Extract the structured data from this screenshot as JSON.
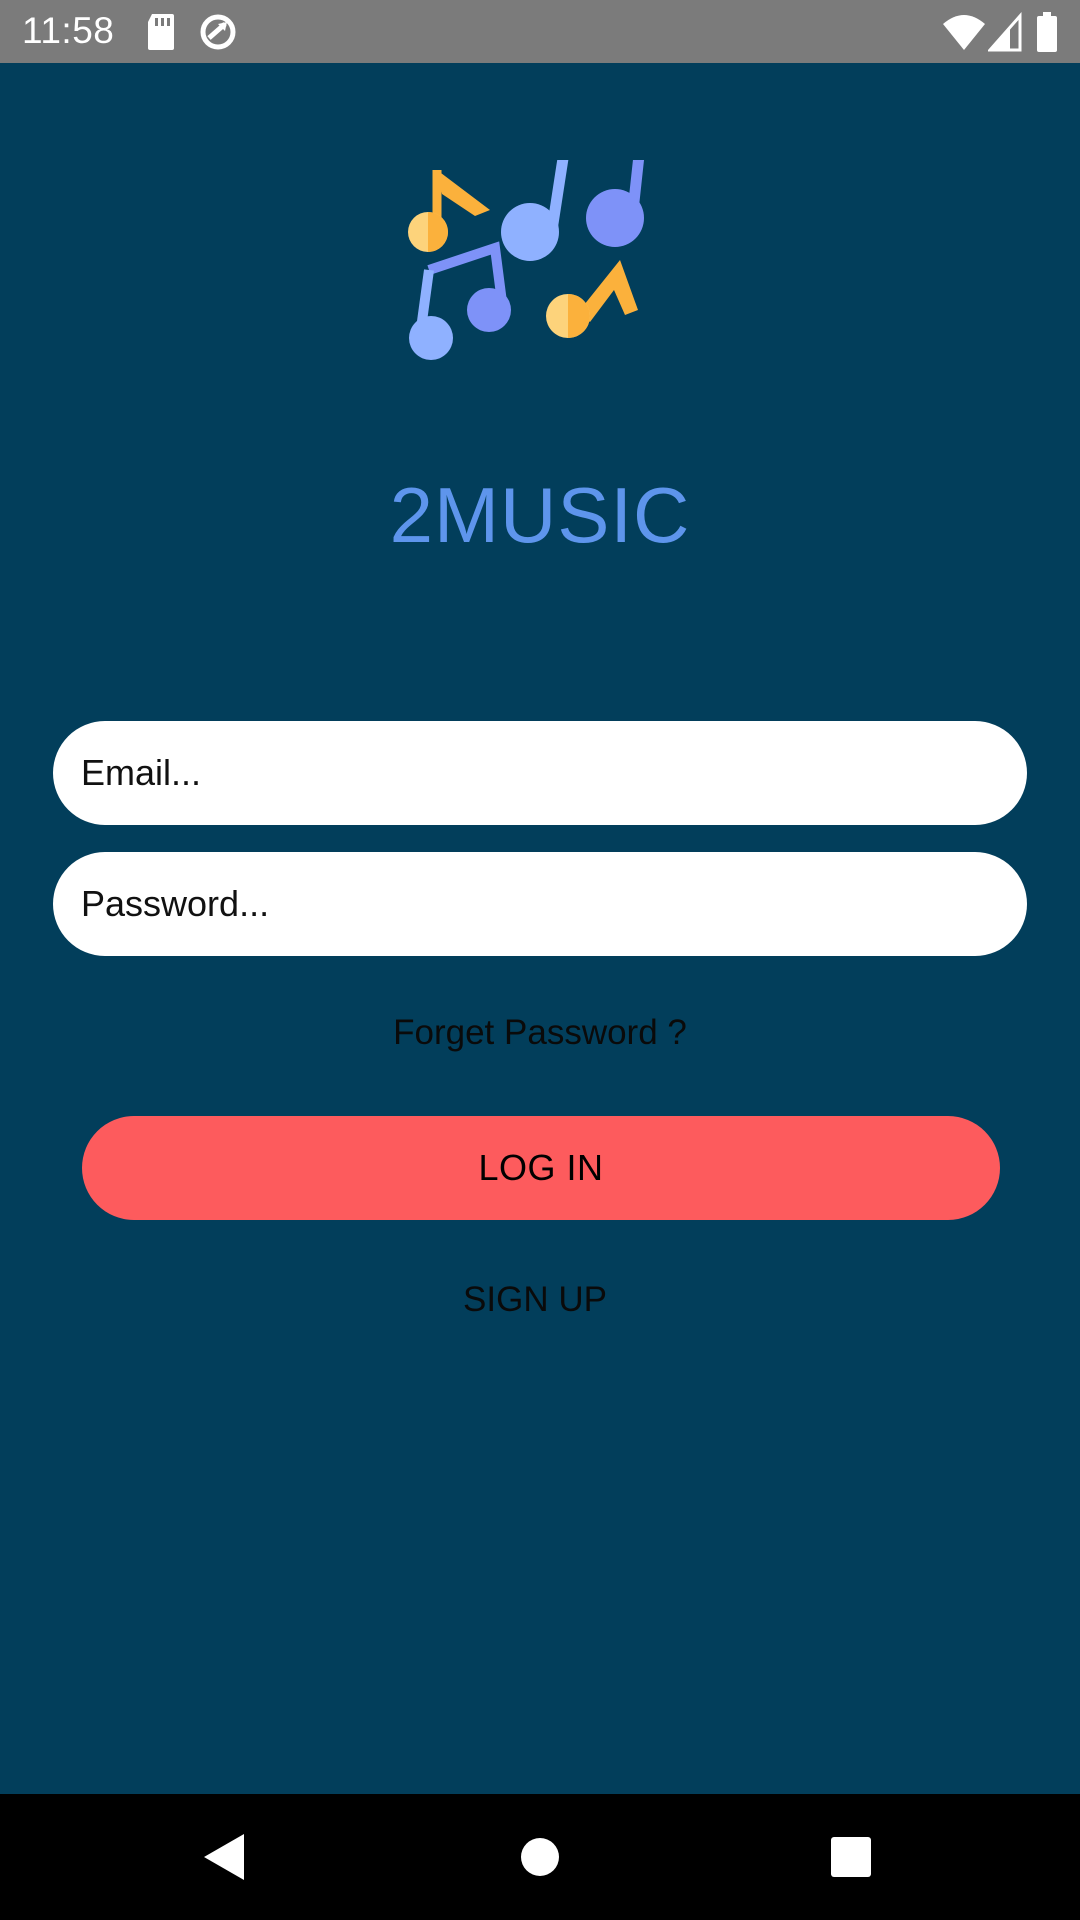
{
  "status_bar": {
    "time": "11:58",
    "icons": [
      "sd-card-icon",
      "sync-icon",
      "wifi-icon",
      "cell-signal-icon",
      "battery-icon"
    ]
  },
  "app": {
    "title": "2MUSIC",
    "logo_icon": "music-notes-icon"
  },
  "form": {
    "email_placeholder": "Email...",
    "email_value": "",
    "password_placeholder": "Password...",
    "password_value": "",
    "forget_password_label": "Forget Password ?",
    "login_label": "LOG IN",
    "signup_label": "SIGN UP"
  },
  "nav_bar": {
    "icons": [
      "back-icon",
      "home-icon",
      "recents-icon"
    ]
  },
  "colors": {
    "background": "#023e5b",
    "title": "#5e95ec",
    "login_button": "#fd5b5d",
    "status_bar": "#7b7b7b",
    "nav_bar": "#000000"
  }
}
